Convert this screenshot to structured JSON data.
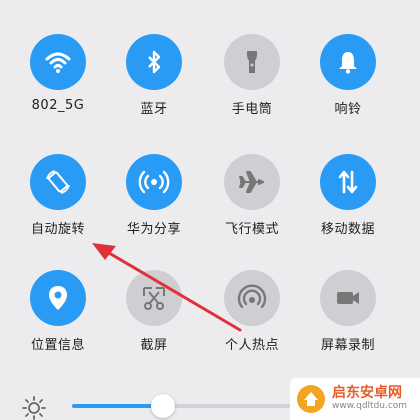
{
  "tiles": [
    {
      "id": "wifi",
      "label": "802_5G",
      "icon": "wifi-icon",
      "state": "on"
    },
    {
      "id": "bluetooth",
      "label": "蓝牙",
      "icon": "bluetooth-icon",
      "state": "on"
    },
    {
      "id": "flashlight",
      "label": "手电筒",
      "icon": "flashlight-icon",
      "state": "off"
    },
    {
      "id": "ringer",
      "label": "响铃",
      "icon": "bell-icon",
      "state": "on"
    },
    {
      "id": "autorotate",
      "label": "自动旋转",
      "icon": "rotate-icon",
      "state": "on"
    },
    {
      "id": "huawei-share",
      "label": "华为分享",
      "icon": "share-signal-icon",
      "state": "on"
    },
    {
      "id": "airplane",
      "label": "飞行模式",
      "icon": "airplane-icon",
      "state": "off"
    },
    {
      "id": "mobile-data",
      "label": "移动数据",
      "icon": "data-arrows-icon",
      "state": "on"
    },
    {
      "id": "location",
      "label": "位置信息",
      "icon": "location-pin-icon",
      "state": "on"
    },
    {
      "id": "screenshot",
      "label": "截屏",
      "icon": "scissors-icon",
      "state": "off"
    },
    {
      "id": "hotspot",
      "label": "个人热点",
      "icon": "hotspot-icon",
      "state": "off"
    },
    {
      "id": "screen-record",
      "label": "屏幕录制",
      "icon": "video-camera-icon",
      "state": "off"
    }
  ],
  "brightness": {
    "icon": "sun-icon",
    "level": 0.38
  },
  "watermark": {
    "title": "启东安卓网",
    "url": "www.qdltdu.com"
  },
  "colors": {
    "active": "#2a9bf5",
    "inactive": "#cfcfd3",
    "arrow": "#e0313a",
    "background": "#ececef"
  }
}
